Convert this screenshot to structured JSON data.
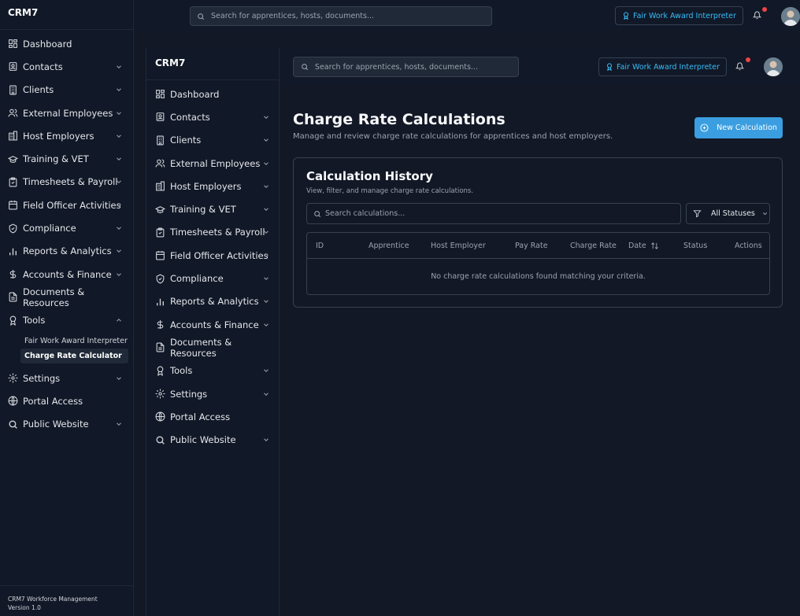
{
  "app": {
    "brand": "CRM7",
    "footer_line1": "CRM7 Workforce Management",
    "footer_line2": "Version 1.0"
  },
  "header": {
    "search_placeholder": "Search for apprentices, hosts, documents...",
    "fair_work_label": "Fair Work Award Interpreter"
  },
  "sidebar": {
    "items": [
      {
        "label": "Dashboard"
      },
      {
        "label": "Contacts"
      },
      {
        "label": "Clients"
      },
      {
        "label": "External Employees"
      },
      {
        "label": "Host Employers"
      },
      {
        "label": "Training & VET"
      },
      {
        "label": "Timesheets & Payroll"
      },
      {
        "label": "Field Officer Activities"
      },
      {
        "label": "Compliance"
      },
      {
        "label": "Reports & Analytics"
      },
      {
        "label": "Accounts & Finance"
      },
      {
        "label": "Documents & Resources"
      },
      {
        "label": "Tools"
      },
      {
        "label": "Settings"
      },
      {
        "label": "Portal Access"
      },
      {
        "label": "Public Website"
      }
    ],
    "tools_sub": [
      {
        "label": "Fair Work Award Interpreter"
      },
      {
        "label": "Charge Rate Calculator"
      }
    ]
  },
  "page": {
    "title": "Charge Rate Calculations",
    "subtitle": "Manage and review charge rate calculations for apprentices and host employers.",
    "new_button": "New Calculation"
  },
  "history": {
    "title": "Calculation History",
    "subtitle": "View, filter, and manage charge rate calculations.",
    "search_placeholder": "Search calculations...",
    "status_filter": "All Statuses",
    "columns": [
      "ID",
      "Apprentice",
      "Host Employer",
      "Pay Rate",
      "Charge Rate",
      "Date",
      "Status",
      "Actions"
    ],
    "empty_message": "No charge rate calculations found matching your criteria."
  },
  "theme": {
    "accent": "#3b9ee0",
    "link": "#38bdf8",
    "notification": "#ef4444",
    "background": "#121826",
    "panel": "#111827"
  }
}
